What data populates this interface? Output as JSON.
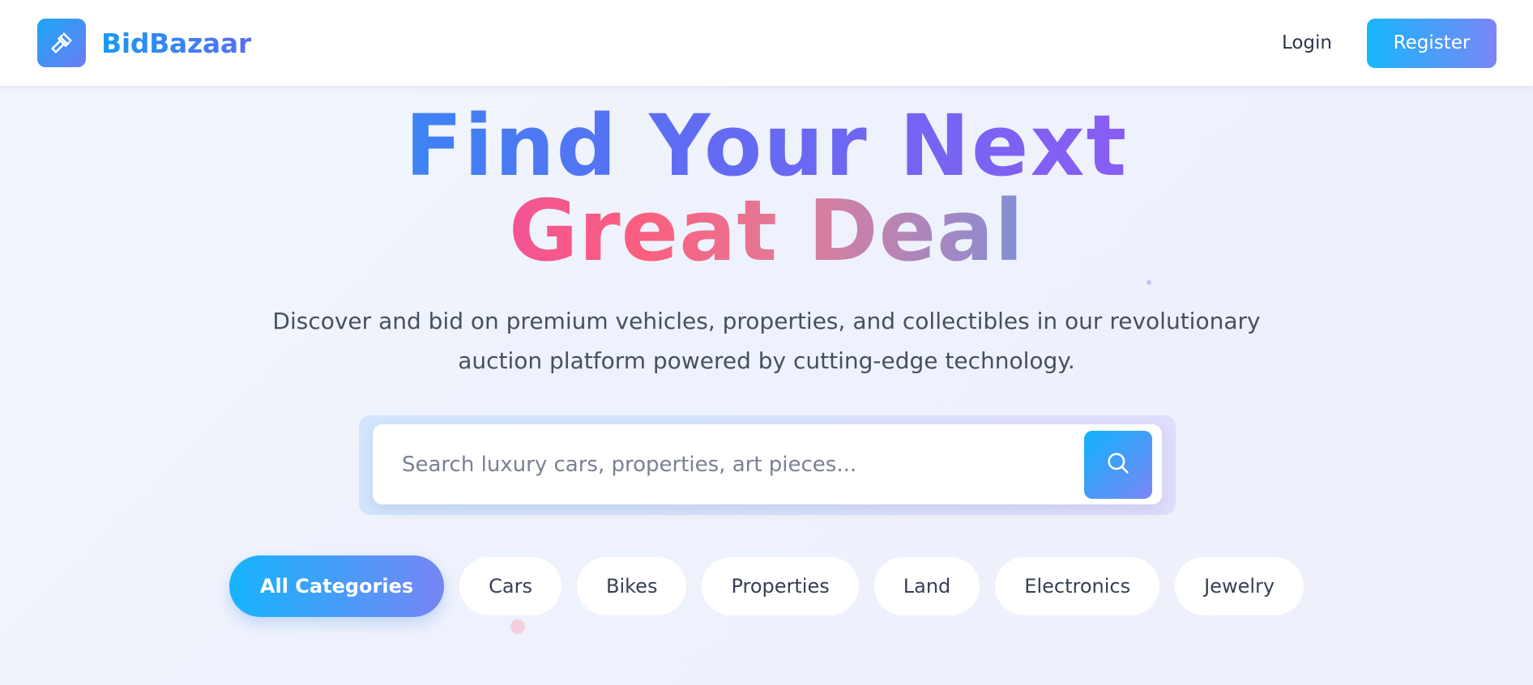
{
  "header": {
    "brand_name": "BidBazaar",
    "logo_icon": "gavel-icon",
    "login_label": "Login",
    "register_label": "Register"
  },
  "hero": {
    "title_line_1": "Find Your Next",
    "title_line_2": "Great Deal",
    "subtitle_line_1": "Discover and bid on premium vehicles, properties, and collectibles in our revolutionary",
    "subtitle_line_2": "auction platform powered by cutting-edge technology."
  },
  "search": {
    "placeholder": "Search luxury cars, properties, art pieces...",
    "value": "",
    "button_icon": "search-icon"
  },
  "categories": [
    {
      "label": "All Categories",
      "active": true
    },
    {
      "label": "Cars",
      "active": false
    },
    {
      "label": "Bikes",
      "active": false
    },
    {
      "label": "Properties",
      "active": false
    },
    {
      "label": "Land",
      "active": false
    },
    {
      "label": "Electronics",
      "active": false
    },
    {
      "label": "Jewelry",
      "active": false
    }
  ],
  "colors": {
    "brand_blue": "#179bf2",
    "brand_violet": "#7685f4",
    "title_pink": "#f0509a"
  }
}
